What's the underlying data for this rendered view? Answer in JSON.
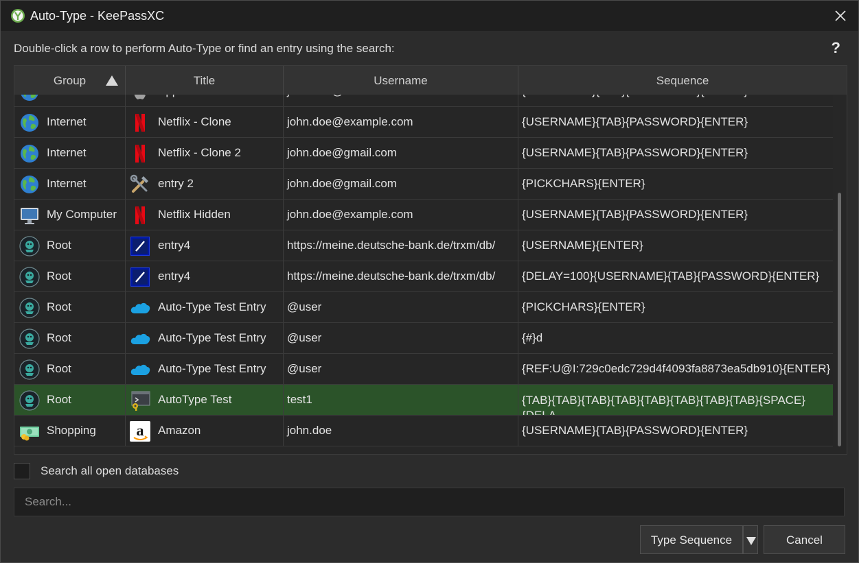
{
  "window": {
    "title": "Auto-Type - KeePassXC",
    "prompt": "Double-click a row to perform Auto-Type or find an entry using the search:",
    "help": "?"
  },
  "table": {
    "columns": [
      "Group",
      "Title",
      "Username",
      "Sequence"
    ],
    "sort_column": "Group",
    "sort_order": "ascending",
    "rows": [
      {
        "group": "Internet",
        "group_icon": "globe-icon",
        "title": "Apple - Clone",
        "title_icon": "apple-logo-icon",
        "username": "john.doe@icloud.com",
        "sequence": "{USERNAME}{TAB}{PASSWORD}{ENTER}"
      },
      {
        "group": "Internet",
        "group_icon": "globe-icon",
        "title": "Netflix - Clone",
        "title_icon": "netflix-logo-icon",
        "username": "john.doe@example.com",
        "sequence": "{USERNAME}{TAB}{PASSWORD}{ENTER}"
      },
      {
        "group": "Internet",
        "group_icon": "globe-icon",
        "title": "Netflix - Clone 2",
        "title_icon": "netflix-logo-icon",
        "username": "john.doe@gmail.com",
        "sequence": "{USERNAME}{TAB}{PASSWORD}{ENTER}"
      },
      {
        "group": "Internet",
        "group_icon": "globe-icon",
        "title": "entry 2",
        "title_icon": "tools-icon",
        "username": "john.doe@gmail.com",
        "sequence": "{PICKCHARS}{ENTER}"
      },
      {
        "group": "My Computer",
        "group_icon": "monitor-icon",
        "title": "Netflix Hidden",
        "title_icon": "netflix-logo-icon",
        "username": "john.doe@example.com",
        "sequence": "{USERNAME}{TAB}{PASSWORD}{ENTER}"
      },
      {
        "group": "Root",
        "group_icon": "keepassxc-root-icon",
        "title": "entry4",
        "title_icon": "deutsche-bank-logo-icon",
        "username": "https://meine.deutsche-bank.de/trxm/db/",
        "sequence": "{USERNAME}{ENTER}"
      },
      {
        "group": "Root",
        "group_icon": "keepassxc-root-icon",
        "title": "entry4",
        "title_icon": "deutsche-bank-logo-icon",
        "username": "https://meine.deutsche-bank.de/trxm/db/",
        "sequence": "{DELAY=100}{USERNAME}{TAB}{PASSWORD}{ENTER}"
      },
      {
        "group": "Root",
        "group_icon": "keepassxc-root-icon",
        "title": "Auto-Type Test Entry",
        "title_icon": "cloud-logo-icon",
        "username": "@user",
        "sequence": "{PICKCHARS}{ENTER}"
      },
      {
        "group": "Root",
        "group_icon": "keepassxc-root-icon",
        "title": "Auto-Type Test Entry",
        "title_icon": "cloud-logo-icon",
        "username": "@user",
        "sequence": "{#}d"
      },
      {
        "group": "Root",
        "group_icon": "keepassxc-root-icon",
        "title": "Auto-Type Test Entry",
        "title_icon": "cloud-logo-icon",
        "username": "@user",
        "sequence": "{REF:U@I:729c0edc729d4f4093fa8873ea5db910}{ENTER}"
      },
      {
        "group": "Root",
        "group_icon": "keepassxc-root-icon",
        "title": "AutoType Test",
        "title_icon": "terminal-key-icon",
        "username": "test1",
        "sequence": "{TAB}{TAB}{TAB}{TAB}{TAB}{TAB}{TAB}{TAB}{SPACE} {DELA",
        "selected": true
      },
      {
        "group": "Shopping",
        "group_icon": "money-icon",
        "title": "Amazon",
        "title_icon": "amazon-logo-icon",
        "username": "john.doe",
        "sequence": "{USERNAME}{TAB}{PASSWORD}{ENTER}"
      }
    ]
  },
  "options": {
    "search_all_label": "Search all open databases",
    "search_all_checked": false
  },
  "search": {
    "placeholder": "Search...",
    "value": ""
  },
  "buttons": {
    "type_sequence": "Type Sequence",
    "cancel": "Cancel"
  },
  "colors": {
    "selected_row": "#2b5329",
    "background": "#2c2c2c",
    "titlebar": "#1f1f1f"
  }
}
